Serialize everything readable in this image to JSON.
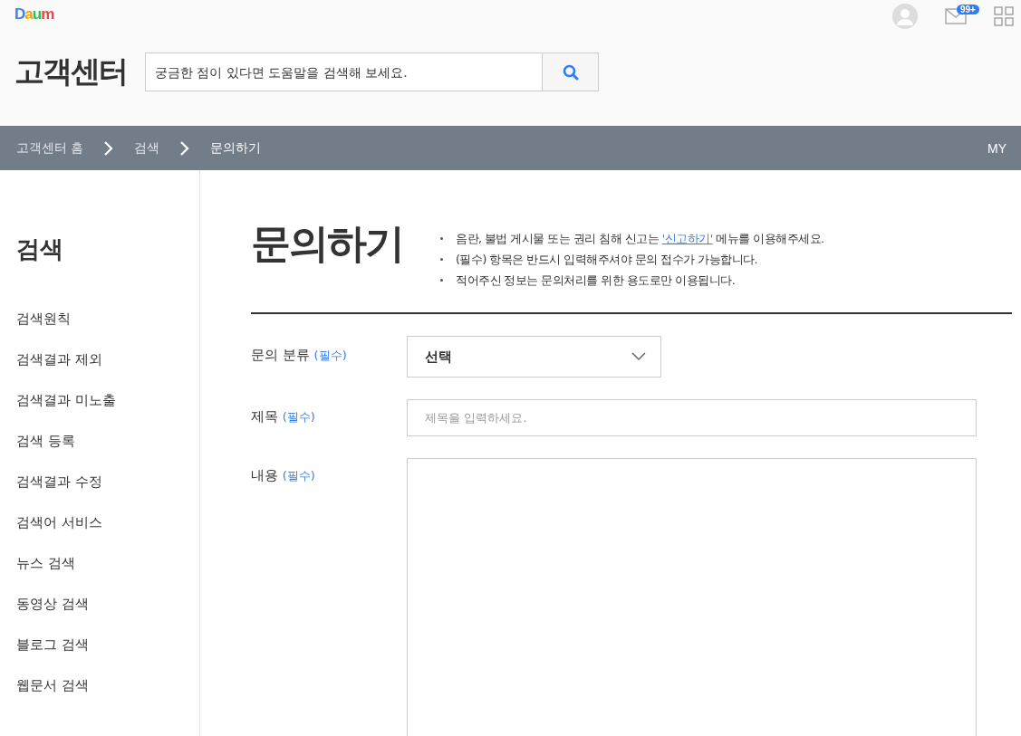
{
  "logo": "Daum",
  "header": {
    "title": "고객센터",
    "search": {
      "placeholder": "궁금한 점이 있다면 도움말을 검색해 보세요."
    },
    "mail_badge": "99+"
  },
  "breadcrumb": {
    "items": [
      {
        "label": "고객센터 홈",
        "selected": false
      },
      {
        "label": "검색",
        "selected": false
      },
      {
        "label": "문의하기",
        "selected": true
      }
    ],
    "my": "MY"
  },
  "sidebar": {
    "title": "검색",
    "items": [
      {
        "label": "검색원칙"
      },
      {
        "label": "검색결과 제외"
      },
      {
        "label": "검색결과 미노출"
      },
      {
        "label": "검색 등록"
      },
      {
        "label": "검색결과 수정"
      },
      {
        "label": "검색어 서비스"
      },
      {
        "label": "뉴스 검색"
      },
      {
        "label": "동영상 검색"
      },
      {
        "label": "블로그 검색"
      },
      {
        "label": "웹문서 검색"
      }
    ]
  },
  "page": {
    "title": "문의하기",
    "notices": [
      {
        "text": "음란, 불법 게시물 또는 권리 침해 신고는 ",
        "link": "'신고하기'",
        "after": " 메뉴를 이용해주세요."
      },
      {
        "text": "(필수) 항목은 반드시 입력해주셔야 문의 접수가 가능합니다."
      },
      {
        "text": "적어주신 정보는 문의처리를 위한 용도로만 이용됩니다."
      }
    ]
  },
  "form": {
    "fields": [
      {
        "kind": "select",
        "label": "문의 분류",
        "required": "(필수)",
        "value": "선택"
      },
      {
        "kind": "input",
        "label": "제목",
        "required": "(필수)",
        "placeholder": "제목을 입력하세요."
      },
      {
        "kind": "textarea",
        "label": "내용",
        "required": "(필수)"
      }
    ]
  }
}
